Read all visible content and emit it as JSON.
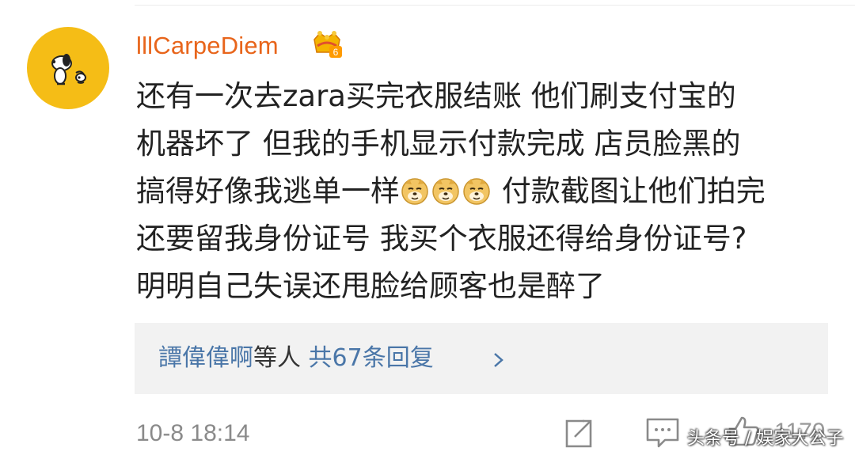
{
  "post": {
    "username": "lllCarpeDiem",
    "badge_level": "6",
    "comment_parts": {
      "line1": "还有一次去zara买完衣服结账 他们刷支付宝的",
      "line2": "机器坏了 但我的手机显示付款完成 店员脸黑的",
      "line3_before_emoji": "搞得好像我逃单一样",
      "line3_after_emoji": " 付款截图让他们拍完",
      "line4": "还要留我身份证号 我买个衣服还得给身份证号?",
      "line5": "明明自己失误还甩脸给顾客也是醉了"
    },
    "emoji_names": [
      "doge-icon",
      "doge-icon",
      "doge-icon"
    ],
    "reply_summary": {
      "replier": "譚偉偉啊",
      "middle": "等人",
      "count_text": "共67条回复"
    },
    "timestamp": "10-8 18:14",
    "like_count": "1179",
    "watermark": "头条号 / 娱家大公子"
  },
  "colors": {
    "username": "#e8651b",
    "link_blue": "#4a76a8",
    "avatar_bg": "#f5bd16",
    "reply_bg": "#f2f2f2",
    "meta_gray": "#8a8a8a"
  }
}
